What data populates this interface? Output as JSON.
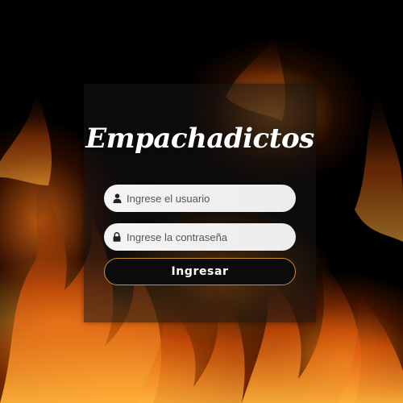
{
  "brand": {
    "title": "Empachadictos"
  },
  "login": {
    "username_placeholder": "Ingrese el usuario",
    "password_placeholder": "Ingrese la contraseña",
    "submit_label": "Ingresar",
    "user_icon": "user-icon",
    "lock_icon": "lock-icon"
  },
  "colors": {
    "card_background": "#141414",
    "button_border": "#c8902e",
    "input_background": "#f5f5f5",
    "flame_primary": "#ff8c1e"
  }
}
